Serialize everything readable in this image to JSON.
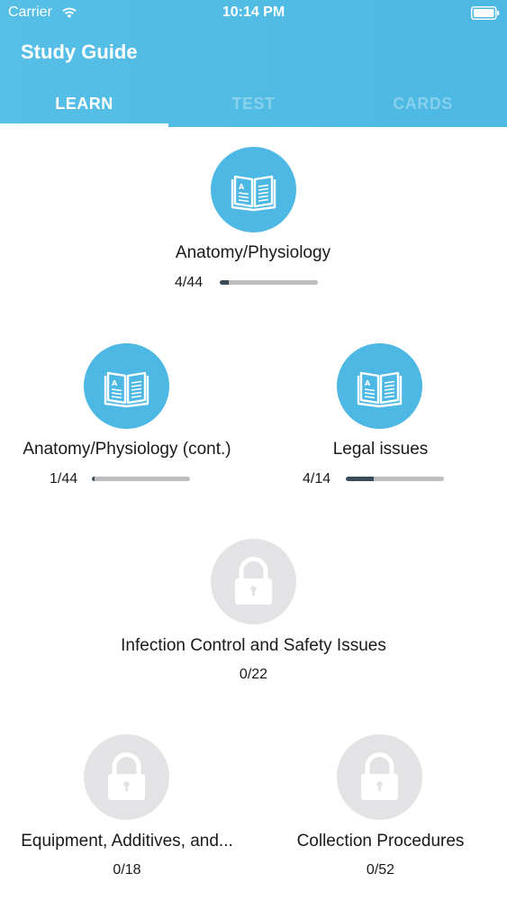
{
  "status_bar": {
    "carrier": "Carrier",
    "time": "10:14 PM"
  },
  "header": {
    "title": "Study Guide"
  },
  "tabs": [
    {
      "label": "LEARN",
      "active": true
    },
    {
      "label": "TEST",
      "active": false
    },
    {
      "label": "CARDS",
      "active": false
    }
  ],
  "colors": {
    "accent": "#4cb8e3",
    "locked": "#e3e3e5",
    "progress_fill": "#3a4a57",
    "progress_track": "#bdbdbf"
  },
  "topics": [
    {
      "name": "Anatomy/Physiology",
      "progress": "4/44",
      "done": 4,
      "total": 44,
      "locked": false,
      "icon": "book-icon"
    },
    {
      "name": "Anatomy/Physiology (cont.)",
      "progress": "1/44",
      "done": 1,
      "total": 44,
      "locked": false,
      "icon": "book-icon"
    },
    {
      "name": "Legal issues",
      "progress": "4/14",
      "done": 4,
      "total": 14,
      "locked": false,
      "icon": "book-icon"
    },
    {
      "name": "Infection Control and Safety Issues",
      "progress": "0/22",
      "done": 0,
      "total": 22,
      "locked": true,
      "icon": "lock-icon"
    },
    {
      "name": "Equipment, Additives, and...",
      "progress": "0/18",
      "done": 0,
      "total": 18,
      "locked": true,
      "icon": "lock-icon"
    },
    {
      "name": "Collection Procedures",
      "progress": "0/52",
      "done": 0,
      "total": 52,
      "locked": true,
      "icon": "lock-icon"
    }
  ]
}
